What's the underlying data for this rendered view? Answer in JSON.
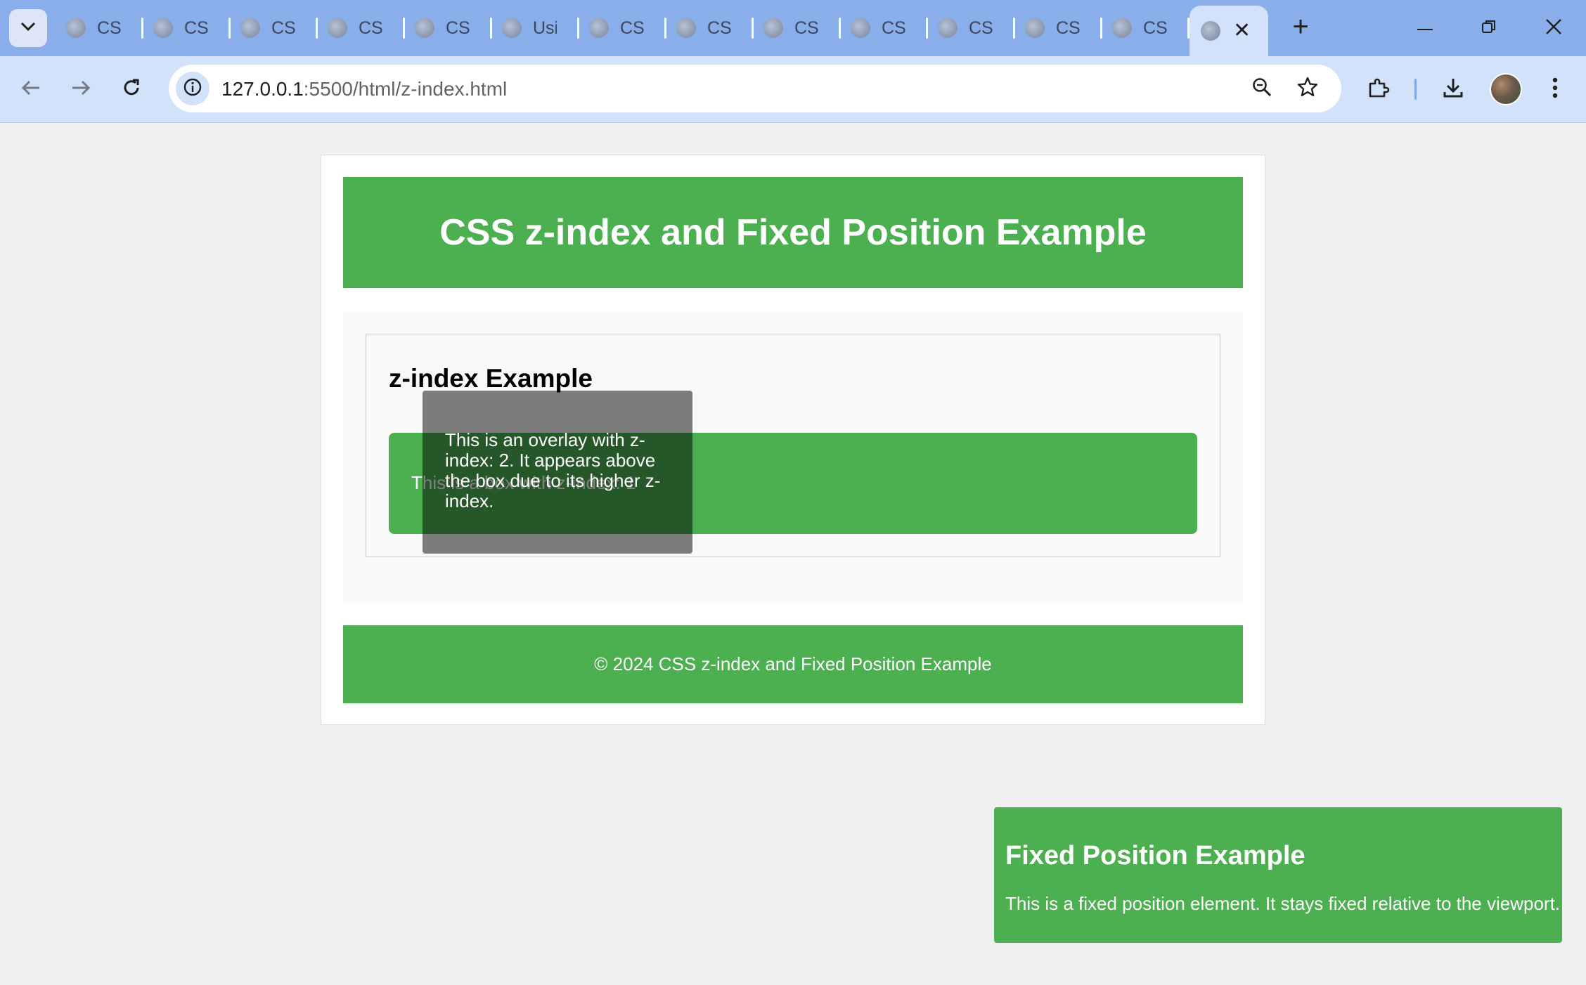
{
  "browser": {
    "tabs": [
      {
        "title": "CSS"
      },
      {
        "title": "CSS"
      },
      {
        "title": "CSS"
      },
      {
        "title": "CSS"
      },
      {
        "title": "CSS"
      },
      {
        "title": "Usi"
      },
      {
        "title": "CSS"
      },
      {
        "title": "CSS"
      },
      {
        "title": "CSS"
      },
      {
        "title": "CSS"
      },
      {
        "title": "CSS"
      },
      {
        "title": "CSS"
      },
      {
        "title": "CSS"
      }
    ],
    "url_host": "127.0.0.1",
    "url_path": ":5500/html/z-index.html",
    "accent_color": "#8aaeea"
  },
  "page": {
    "header_title": "CSS z-index and Fixed Position Example",
    "section_title": "z-index Example",
    "box_text": "This is a box with z-index: 1",
    "overlay_text": "This is an overlay with z-index: 2. It appears above the box due to its higher z-index.",
    "footer_text": "© 2024 CSS z-index and Fixed Position Example",
    "fixed_title": "Fixed Position Example",
    "fixed_text": "This is a fixed position element. It stays fixed relative to the viewport.",
    "brand_color": "#4caf50"
  }
}
